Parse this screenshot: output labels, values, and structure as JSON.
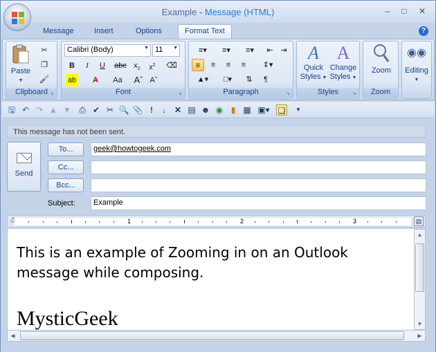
{
  "window": {
    "title_doc": "Example",
    "title_sep": " - ",
    "title_app": "Message (HTML)"
  },
  "tabs": [
    {
      "label": "Message"
    },
    {
      "label": "Insert"
    },
    {
      "label": "Options"
    },
    {
      "label": "Format Text",
      "active": true
    }
  ],
  "ribbon": {
    "clipboard": {
      "label": "Clipboard",
      "paste": "Paste"
    },
    "font": {
      "label": "Font",
      "family": "Calibri (Body)",
      "size": "11"
    },
    "paragraph": {
      "label": "Paragraph"
    },
    "styles": {
      "label": "Styles",
      "quick_styles_1": "Quick",
      "quick_styles_2": "Styles",
      "change_styles_1": "Change",
      "change_styles_2": "Styles"
    },
    "zoom": {
      "label": "Zoom",
      "zoom_btn": "Zoom"
    },
    "editing": {
      "label": "Editing"
    }
  },
  "infobar": {
    "text": "This message has not been sent."
  },
  "compose": {
    "send": "Send",
    "to_btn": "To...",
    "cc_btn": "Cc...",
    "bcc_btn": "Bcc...",
    "subject_label": "Subject:",
    "to_value": "geek@howtogeek.com",
    "cc_value": "",
    "bcc_value": "",
    "subject_value": "Example"
  },
  "ruler": {
    "numbers": [
      "1",
      "2",
      "3"
    ]
  },
  "body": {
    "text": "This is an example of Zooming in on an Outlook message while composing.",
    "signature": "MysticGeek"
  },
  "colors": {
    "accent": "#15428b",
    "title_app": "#2a7bd0",
    "ribbon_bg": "#c9d9ee"
  }
}
